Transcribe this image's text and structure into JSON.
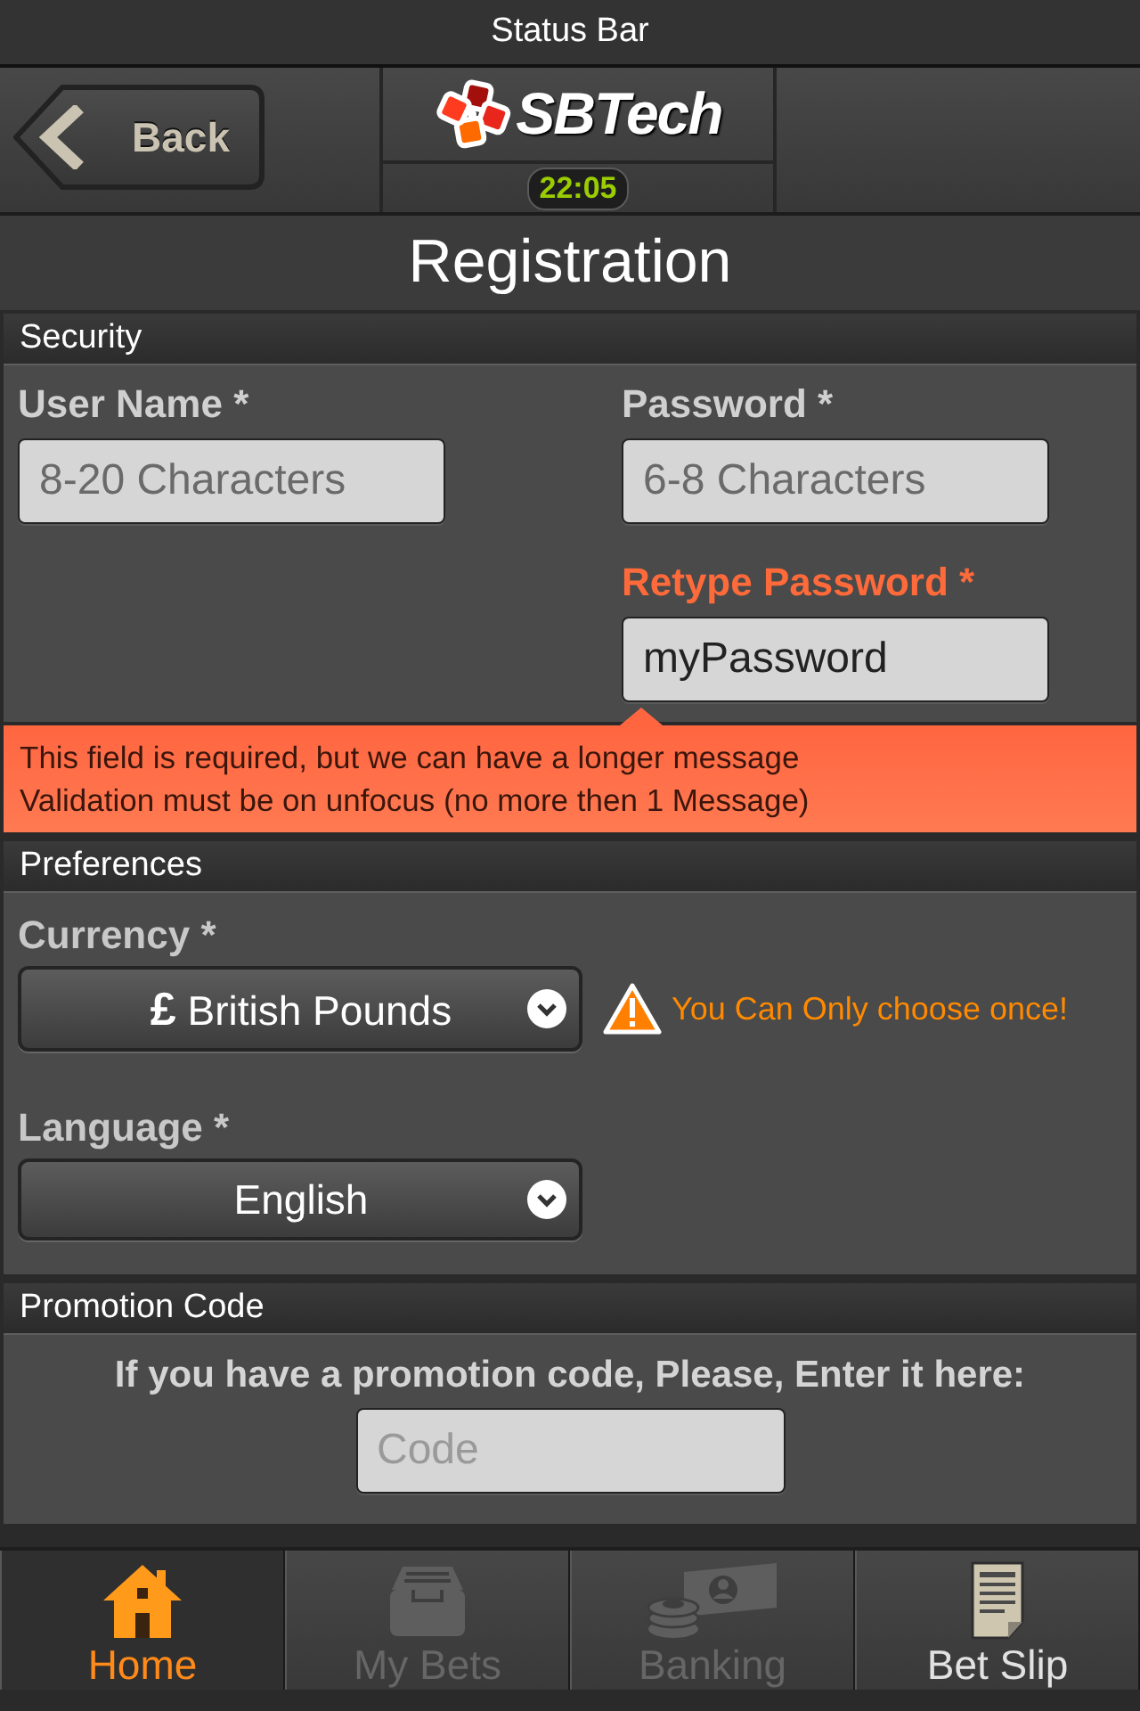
{
  "status_bar": {
    "title": "Status Bar"
  },
  "header": {
    "back_button": "Back",
    "logo_text": "SBTech",
    "clock": "22:05"
  },
  "title": "Registration",
  "security": {
    "title": "Security",
    "fields": [
      {
        "label": "User Name *",
        "placeholder": "8-20 Characters",
        "error": false
      },
      {
        "label": "Password *",
        "placeholder": "6-8 Characters",
        "error": false
      },
      {
        "label": "Retype Password *",
        "value": "myPassword",
        "error": true
      }
    ],
    "error_message": [
      "This field is required, but we can have a longer message",
      "Validation must be on unfocus (no more then 1 Message)"
    ]
  },
  "preferences": {
    "title": "Preferences",
    "selects": [
      {
        "label": "Currency *",
        "value": "**£** British Pounds",
        "warning": "You Can Only choose once!"
      },
      {
        "label": "Language *",
        "value": "English"
      }
    ]
  },
  "promotion": {
    "title": "Promotion Code",
    "prompt": "If you have a promotion code, Please, Enter it here:",
    "placeholder": "Code"
  },
  "tab_bar": [
    {
      "label": "Home",
      "selected": true,
      "disabled": false
    },
    {
      "label": "My Bets",
      "selected": false,
      "disabled": true
    },
    {
      "label": "Banking",
      "selected": false,
      "disabled": true
    },
    {
      "label": "Bet Slip",
      "selected": false,
      "disabled": false
    }
  ]
}
